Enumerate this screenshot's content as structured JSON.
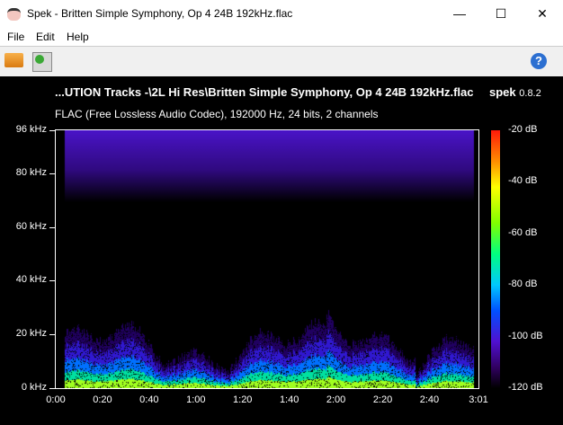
{
  "window": {
    "title": "Spek - Britten Simple Symphony, Op 4 24B 192kHz.flac",
    "minimize": "—",
    "maximize": "☐",
    "close": "✕"
  },
  "menu": [
    "File",
    "Edit",
    "Help"
  ],
  "toolbar": {
    "open_icon": "folder-open-icon",
    "save_icon": "save-icon",
    "help_icon": "help-icon",
    "help_glyph": "?"
  },
  "spectrogram": {
    "file_label": "...UTION Tracks -\\2L Hi Res\\Britten Simple Symphony, Op 4 24B 192kHz.flac",
    "app_name": "spek",
    "app_version": "0.8.2",
    "info": "FLAC (Free Lossless Audio Codec), 192000 Hz, 24 bits, 2 channels",
    "freq_ticks": [
      "96 kHz",
      "80 kHz",
      "60 kHz",
      "40 kHz",
      "20 kHz",
      "0 kHz"
    ],
    "time_ticks": [
      "0:00",
      "0:20",
      "0:40",
      "1:00",
      "1:20",
      "1:40",
      "2:00",
      "2:20",
      "2:40",
      "3:01"
    ],
    "db_ticks": [
      "-20 dB",
      "-40 dB",
      "-60 dB",
      "-80 dB",
      "-100 dB",
      "-120 dB"
    ]
  }
}
